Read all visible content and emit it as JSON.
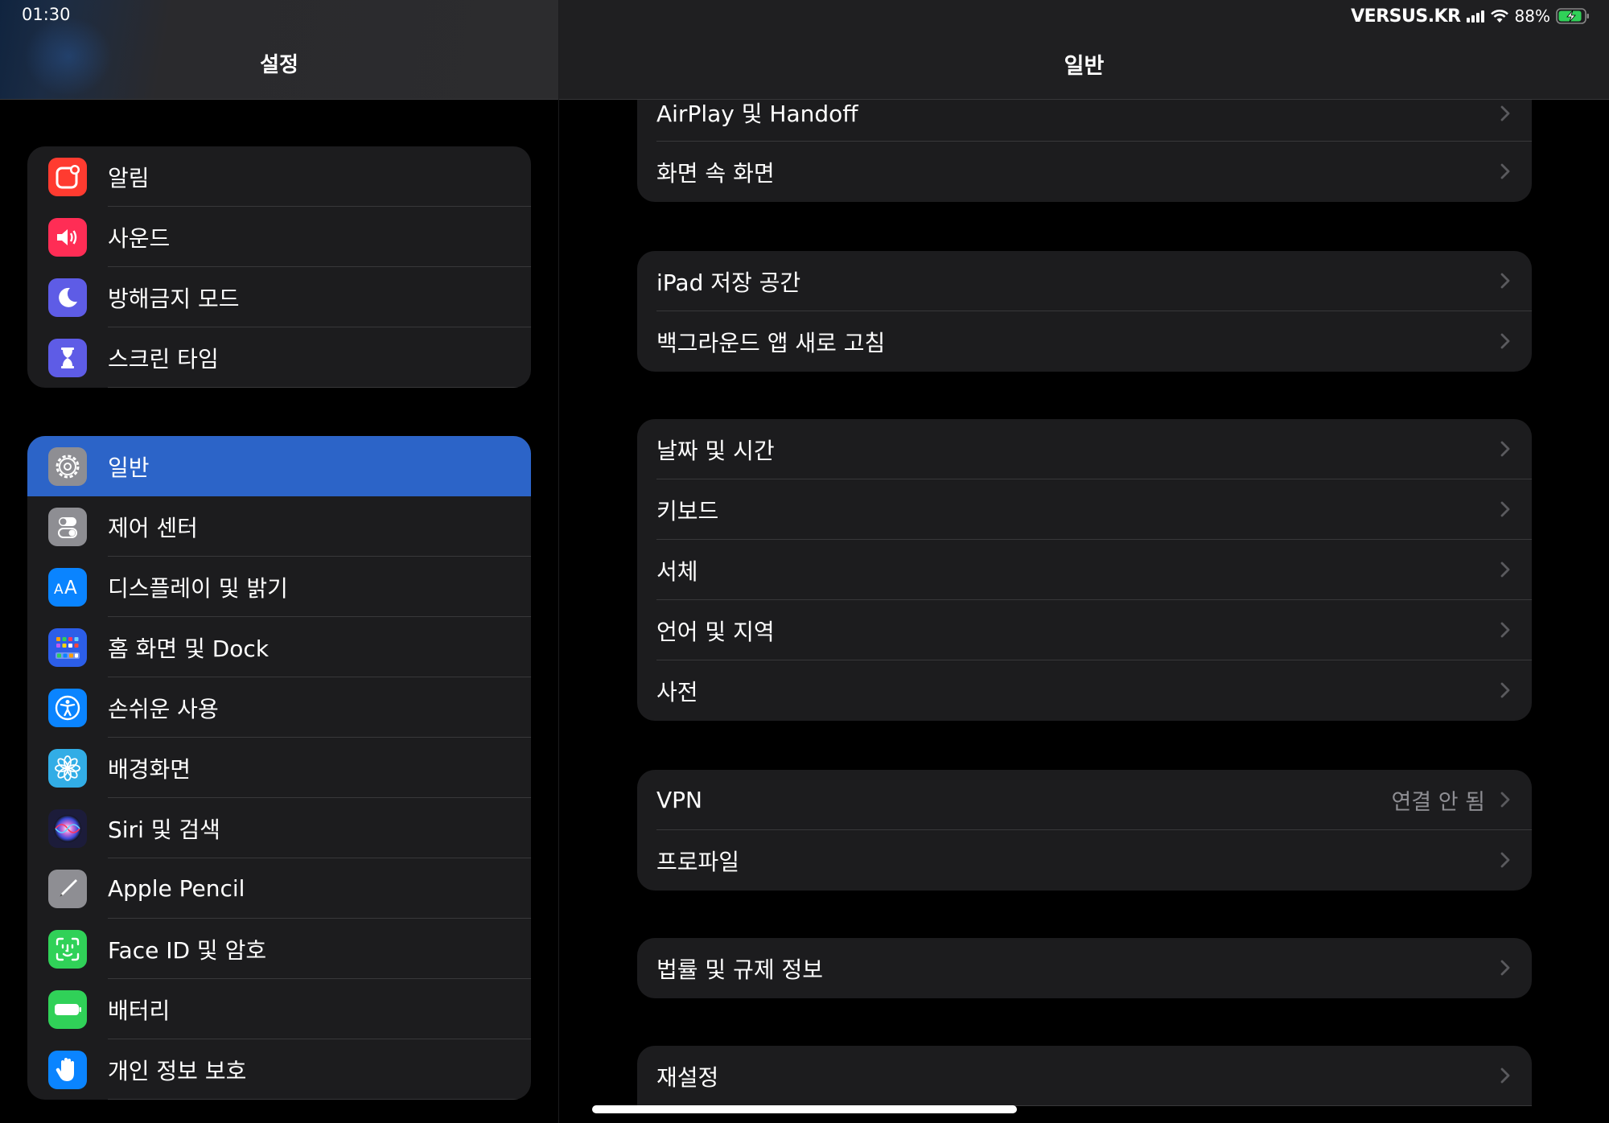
{
  "status": {
    "time": "01:30",
    "carrier": "VERSUS.KR",
    "battery": "88%",
    "battery_color": "#30d158"
  },
  "left": {
    "title": "설정",
    "groups": [
      [
        {
          "label": "알림",
          "icon": "notifications-icon",
          "color": "#ff3b30"
        },
        {
          "label": "사운드",
          "icon": "speaker-icon",
          "color": "#ff2d55"
        },
        {
          "label": "방해금지 모드",
          "icon": "moon-icon",
          "color": "#5e5ce6"
        },
        {
          "label": "스크린 타임",
          "icon": "hourglass-icon",
          "color": "#5e5ce6"
        }
      ],
      [
        {
          "label": "일반",
          "icon": "gear-icon",
          "color": "#8e8e93",
          "selected": true
        },
        {
          "label": "제어 센터",
          "icon": "switches-icon",
          "color": "#8e8e93"
        },
        {
          "label": "디스플레이 및 밝기",
          "icon": "text-size-icon",
          "color": "#0a84ff"
        },
        {
          "label": "홈 화면 및 Dock",
          "icon": "app-grid-icon",
          "color": "#2c5ee8"
        },
        {
          "label": "손쉬운 사용",
          "icon": "accessibility-icon",
          "color": "#0a84ff"
        },
        {
          "label": "배경화면",
          "icon": "flower-icon",
          "color": "#32ade6"
        },
        {
          "label": "Siri 및 검색",
          "icon": "siri-icon",
          "color": "#1c1c3a"
        },
        {
          "label": "Apple Pencil",
          "icon": "pencil-icon",
          "color": "#8e8e93"
        },
        {
          "label": "Face ID 및 암호",
          "icon": "face-id-icon",
          "color": "#30d158"
        },
        {
          "label": "배터리",
          "icon": "battery-icon",
          "color": "#30d158"
        },
        {
          "label": "개인 정보 보호",
          "icon": "hand-icon",
          "color": "#0a84ff"
        }
      ]
    ]
  },
  "right": {
    "title": "일반",
    "groups": [
      [
        {
          "label": "AirPlay 및 Handoff"
        },
        {
          "label": "화면 속 화면"
        }
      ],
      [
        {
          "label": "iPad 저장 공간"
        },
        {
          "label": "백그라운드 앱 새로 고침"
        }
      ],
      [
        {
          "label": "날짜 및 시간"
        },
        {
          "label": "키보드"
        },
        {
          "label": "서체"
        },
        {
          "label": "언어 및 지역"
        },
        {
          "label": "사전"
        }
      ],
      [
        {
          "label": "VPN",
          "value": "연결 안 됨"
        },
        {
          "label": "프로파일"
        }
      ],
      [
        {
          "label": "법률 및 규제 정보"
        }
      ],
      [
        {
          "label": "재설정"
        }
      ]
    ]
  }
}
